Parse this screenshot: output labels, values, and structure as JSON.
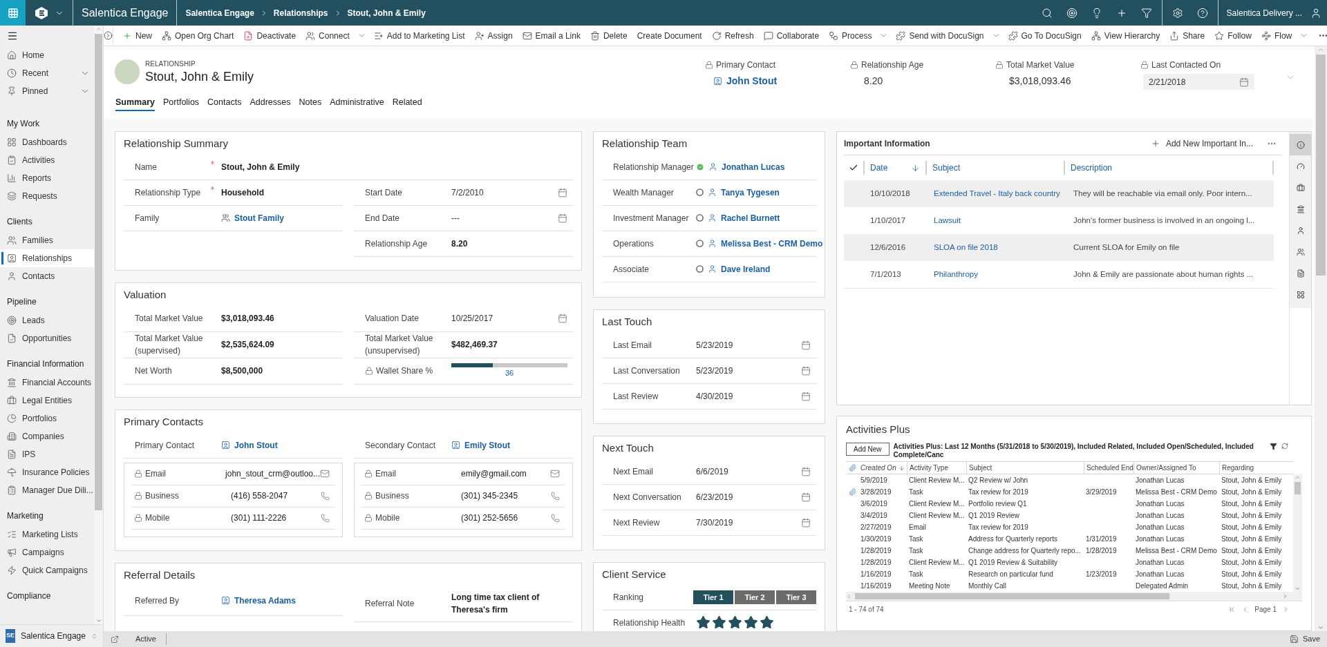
{
  "app_bar": {
    "app_name": "Salentica Engage",
    "breadcrumbs": [
      "Salentica Engage",
      "Relationships",
      "Stout, John & Emily"
    ],
    "user_name": "Salentica Delivery ..."
  },
  "sidebar": {
    "top_items": [
      {
        "label": "Home",
        "kind": "link",
        "selected": false
      },
      {
        "label": "Recent",
        "kind": "menu",
        "selected": false
      },
      {
        "label": "Pinned",
        "kind": "menu",
        "selected": false
      }
    ],
    "groups": [
      {
        "title": "My Work",
        "items": [
          {
            "label": "Dashboards",
            "selected": false
          },
          {
            "label": "Activities",
            "selected": false
          },
          {
            "label": "Reports",
            "selected": false
          },
          {
            "label": "Requests",
            "selected": false
          }
        ]
      },
      {
        "title": "Clients",
        "items": [
          {
            "label": "Families",
            "selected": false
          },
          {
            "label": "Relationships",
            "selected": true
          },
          {
            "label": "Contacts",
            "selected": false
          }
        ]
      },
      {
        "title": "Pipeline",
        "items": [
          {
            "label": "Leads",
            "selected": false
          },
          {
            "label": "Opportunities",
            "selected": false
          }
        ]
      },
      {
        "title": "Financial Information",
        "items": [
          {
            "label": "Financial Accounts",
            "selected": false
          },
          {
            "label": "Legal Entities",
            "selected": false
          },
          {
            "label": "Portfolios",
            "selected": false
          },
          {
            "label": "Companies",
            "selected": false
          },
          {
            "label": "IPS",
            "selected": false
          },
          {
            "label": "Insurance Policies",
            "selected": false
          },
          {
            "label": "Manager Due Dili...",
            "selected": false
          }
        ]
      },
      {
        "title": "Marketing",
        "items": [
          {
            "label": "Marketing Lists",
            "selected": false
          },
          {
            "label": "Campaigns",
            "selected": false
          },
          {
            "label": "Quick Campaigns",
            "selected": false
          }
        ]
      },
      {
        "title": "Compliance"
      }
    ],
    "area": {
      "badge": "SE",
      "label": "Salentica Engage"
    }
  },
  "command_bar": [
    {
      "label": "New",
      "has_menu": false
    },
    {
      "label": "Open Org Chart",
      "has_menu": false
    },
    {
      "label": "Deactivate",
      "has_menu": false
    },
    {
      "label": "Connect",
      "has_menu": true
    },
    {
      "label": "Add to Marketing List",
      "has_menu": false
    },
    {
      "label": "Assign",
      "has_menu": false
    },
    {
      "label": "Email a Link",
      "has_menu": false
    },
    {
      "label": "Delete",
      "has_menu": false
    },
    {
      "label": "Create Document",
      "has_menu": false
    },
    {
      "label": "Refresh",
      "has_menu": false
    },
    {
      "label": "Collaborate",
      "has_menu": false
    },
    {
      "label": "Process",
      "has_menu": true
    },
    {
      "label": "Send with DocuSign",
      "has_menu": true
    },
    {
      "label": "Go To DocuSign",
      "has_menu": false
    },
    {
      "label": "View Hierarchy",
      "has_menu": false
    },
    {
      "label": "Share",
      "has_menu": false
    },
    {
      "label": "Follow",
      "has_menu": false
    },
    {
      "label": "Flow",
      "has_menu": true
    }
  ],
  "header": {
    "entity_type": "RELATIONSHIP",
    "title": "Stout, John & Emily",
    "fields": [
      {
        "label": "Primary Contact",
        "value": "John Stout",
        "kind": "contact_link",
        "locked": true
      },
      {
        "label": "Relationship Age",
        "value": "8.20",
        "kind": "plain",
        "locked": true
      },
      {
        "label": "Total Market Value",
        "value": "$3,018,093.46",
        "kind": "plain",
        "locked": true
      },
      {
        "label": "Last Contacted On",
        "value": "2/21/2018",
        "kind": "date_input",
        "locked": true
      }
    ]
  },
  "tabs": [
    {
      "label": "Summary",
      "selected": true
    },
    {
      "label": "Portfolios",
      "selected": false
    },
    {
      "label": "Contacts",
      "selected": false
    },
    {
      "label": "Addresses",
      "selected": false
    },
    {
      "label": "Notes",
      "selected": false
    },
    {
      "label": "Administrative",
      "selected": false
    },
    {
      "label": "Related",
      "selected": false
    }
  ],
  "relationship_summary": {
    "title": "Relationship Summary",
    "top_field": {
      "label": "Name",
      "value": "Stout, John & Emily",
      "kind": "text",
      "required": true
    },
    "left": [
      {
        "label": "Relationship Type",
        "value": "Household",
        "kind": "text",
        "required": true
      },
      {
        "label": "Family",
        "value": "Stout Family",
        "kind": "family_link",
        "required": false
      }
    ],
    "right": [
      {
        "label": "Start Date",
        "value": "7/2/2010",
        "kind": "date"
      },
      {
        "label": "End Date",
        "value": "---",
        "kind": "date"
      },
      {
        "label": "Relationship Age",
        "value": "8.20",
        "kind": "text"
      }
    ]
  },
  "valuation": {
    "title": "Valuation",
    "left": [
      {
        "label": "Total Market Value",
        "value": "$3,018,093.46",
        "kind": "text"
      },
      {
        "label": "Total Market Value (supervised)",
        "value": "$2,535,624.09",
        "kind": "text"
      },
      {
        "label": "Net Worth",
        "value": "$8,500,000",
        "kind": "text"
      }
    ],
    "right": [
      {
        "label": "Valuation Date",
        "value": "10/25/2017",
        "kind": "date",
        "locked": false
      },
      {
        "label": "Total Market Value (unsupervised)",
        "value": "$482,469.37",
        "kind": "text",
        "locked": false
      },
      {
        "label": "Wallet Share %",
        "kind": "bar",
        "level": 0.36,
        "reading": "36",
        "locked": true
      }
    ]
  },
  "primary_contacts": {
    "title": "Primary Contacts",
    "contacts": [
      {
        "label": "Primary Contact",
        "name": "John Stout",
        "details": [
          {
            "label": "Email",
            "value": "john_stout_crm@outloo...",
            "kind": "email",
            "locked": true
          },
          {
            "label": "Business",
            "value": "(416) 558-2047",
            "kind": "phone",
            "locked": true
          },
          {
            "label": "Mobile",
            "value": "(301) 111-2226",
            "kind": "phone",
            "locked": true
          }
        ]
      },
      {
        "label": "Secondary Contact",
        "name": "Emily Stout",
        "details": [
          {
            "label": "Email",
            "value": "emily@gmail.com",
            "kind": "email",
            "locked": true
          },
          {
            "label": "Business",
            "value": "(301) 345-2345",
            "kind": "phone",
            "locked": true
          },
          {
            "label": "Mobile",
            "value": "(301) 252-5656",
            "kind": "phone",
            "locked": true
          }
        ]
      }
    ]
  },
  "referral_details": {
    "title": "Referral Details",
    "left": [
      {
        "label": "Referred By",
        "value": "Theresa Adams",
        "kind": "contact_link"
      }
    ],
    "right": [
      {
        "label": "Referral Note",
        "value": "Long time tax client of Theresa's firm",
        "kind": "text"
      }
    ]
  },
  "relationship_team": {
    "title": "Relationship Team",
    "members": [
      {
        "role": "Relationship Manager",
        "name": "Jonathan Lucas",
        "available": true
      },
      {
        "role": "Wealth Manager",
        "name": "Tanya Tygesen",
        "available": false
      },
      {
        "role": "Investment Manager",
        "name": "Rachel Burnett",
        "available": false
      },
      {
        "role": "Operations",
        "name": "Melissa Best - CRM Demo",
        "available": false
      },
      {
        "role": "Associate",
        "name": "Dave Ireland",
        "available": false
      }
    ]
  },
  "last_touch": {
    "title": "Last Touch",
    "fields": [
      {
        "label": "Last Email",
        "value": "5/23/2019",
        "kind": "date"
      },
      {
        "label": "Last Conversation",
        "value": "5/23/2019",
        "kind": "date"
      },
      {
        "label": "Last Review",
        "value": "4/30/2019",
        "kind": "date"
      }
    ]
  },
  "next_touch": {
    "title": "Next Touch",
    "fields": [
      {
        "label": "Next Email",
        "value": "6/6/2019",
        "kind": "date"
      },
      {
        "label": "Next Conversation",
        "value": "6/23/2019",
        "kind": "date"
      },
      {
        "label": "Next Review",
        "value": "7/30/2019",
        "kind": "date"
      }
    ]
  },
  "client_service": {
    "title": "Client Service",
    "ranking_label": "Ranking",
    "tiers": [
      {
        "label": "Tier 1",
        "selected": true
      },
      {
        "label": "Tier 2",
        "selected": false
      },
      {
        "label": "Tier 3",
        "selected": false
      }
    ],
    "health_label": "Relationship Health",
    "stars": 5
  },
  "important_information": {
    "title": "Important Information",
    "add_label": "Add New Important In...",
    "columns": [
      {
        "label": "Date",
        "sorted": true
      },
      {
        "label": "Subject",
        "sorted": false
      },
      {
        "label": "Description",
        "sorted": false
      }
    ],
    "rows": [
      {
        "date": "10/10/2018",
        "subject": "Extended Travel - Italy back country",
        "description": "They will be reachable via email only. Poor intern..."
      },
      {
        "date": "1/10/2017",
        "subject": "Lawsuit",
        "description": "John's former business is involved in an ongoing l..."
      },
      {
        "date": "12/6/2016",
        "subject": "SLOA on file 2018",
        "description": "Current SLOA for Emily on file"
      },
      {
        "date": "7/1/2013",
        "subject": "Philanthropy",
        "description": "John & Emily are passionate about human rights ..."
      }
    ],
    "side_tabs": [
      {
        "selected": true
      },
      {
        "selected": false
      },
      {
        "selected": false
      },
      {
        "selected": false
      },
      {
        "selected": false
      },
      {
        "selected": false
      },
      {
        "selected": false
      },
      {
        "selected": false
      }
    ]
  },
  "activities": {
    "title": "Activities Plus",
    "add_label": "Add New",
    "view_label": "Activities Plus: Last 12 Months (5/31/2018 to 5/30/2019), Included Related, Included Open/Scheduled, Included Complete/Canc",
    "columns": [
      {
        "label": "Created On",
        "sorted": true
      },
      {
        "label": "Activity Type",
        "sorted": false
      },
      {
        "label": "Subject",
        "sorted": false
      },
      {
        "label": "Scheduled End",
        "sorted": false
      },
      {
        "label": "Owner/Assigned To",
        "sorted": false
      },
      {
        "label": "Regarding",
        "sorted": false
      }
    ],
    "rows": [
      {
        "attachment": false,
        "cells": [
          "5/9/2019",
          "Client Review M...",
          "Q2 Review w/ John",
          "",
          "Jonathan Lucas",
          "Stout, John & Emily"
        ]
      },
      {
        "attachment": true,
        "cells": [
          "3/28/2019",
          "Task",
          "Tax review for 2019",
          "3/29/2019",
          "Melissa Best - CRM Demo",
          "Stout, John & Emily"
        ]
      },
      {
        "attachment": false,
        "cells": [
          "3/6/2019",
          "Client Review M...",
          "Portfolio review Q1",
          "",
          "Jonathan Lucas",
          "Stout, John & Emily"
        ]
      },
      {
        "attachment": false,
        "cells": [
          "3/4/2019",
          "Client Review M...",
          "Q1 2019 Review",
          "",
          "Jonathan Lucas",
          "Stout, John & Emily"
        ]
      },
      {
        "attachment": false,
        "cells": [
          "2/27/2019",
          "Email",
          "Tax review for 2019",
          "",
          "Jonathan Lucas",
          "Stout, John & Emily"
        ]
      },
      {
        "attachment": false,
        "cells": [
          "1/30/2019",
          "Task",
          "Address for Quarterly reports",
          "1/31/2019",
          "Jonathan Lucas",
          "Stout, John & Emily"
        ]
      },
      {
        "attachment": false,
        "cells": [
          "1/28/2019",
          "Task",
          "Change address for Quarterly repo...",
          "1/28/2019",
          "Melissa Best - CRM Demo",
          "Stout, John & Emily"
        ]
      },
      {
        "attachment": false,
        "cells": [
          "1/28/2019",
          "Client Review M...",
          "Q1 2019 Review & Suitability",
          "",
          "Jonathan Lucas",
          "Stout, John & Emily"
        ]
      },
      {
        "attachment": false,
        "cells": [
          "1/16/2019",
          "Task",
          "Research on particular fund",
          "1/23/2019",
          "Jonathan Lucas",
          "Stout, John & Emily"
        ]
      },
      {
        "attachment": false,
        "cells": [
          "1/16/2019",
          "Meeting Note",
          "Monthly Call",
          "",
          "Delegated Admin",
          "Stout, John & Emily"
        ]
      }
    ],
    "record_count": "1 - 74 of 74",
    "page": "Page 1"
  },
  "status_bar": {
    "status": "Active",
    "save_label": "Save"
  }
}
